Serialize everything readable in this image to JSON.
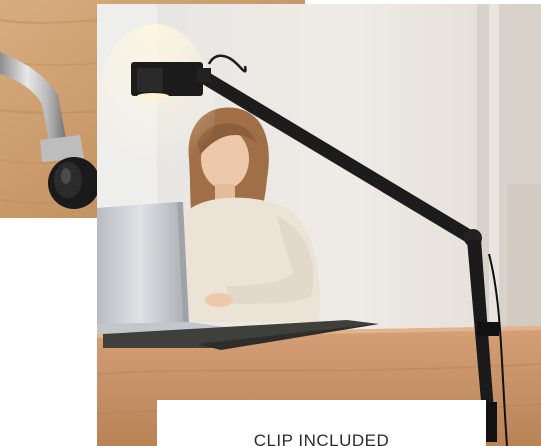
{
  "caption": {
    "text": "CLIP INCLUDED"
  },
  "images": {
    "inset": {
      "description_icon": "chair-caster-photo"
    },
    "main": {
      "description_icon": "desk-lamp-woman-laptop-photo"
    }
  },
  "colors": {
    "wood_light": "#d2a677",
    "wood_dark": "#b07e50",
    "wall": "#ece7e2",
    "desk": "#c8946a",
    "lamp": "#1b1b1b",
    "sweater": "#e9e1d3",
    "hair": "#a0704a",
    "laptop": "#c9cdd2"
  }
}
